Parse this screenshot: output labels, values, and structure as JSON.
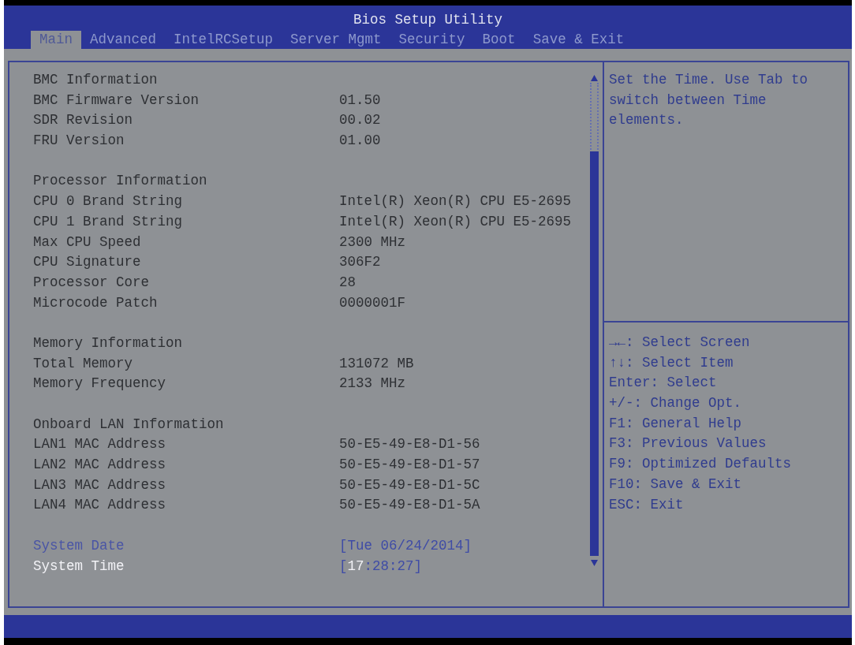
{
  "window": {
    "title": "Bios Setup Utility"
  },
  "tabs": [
    {
      "label": "Main",
      "selected": true
    },
    {
      "label": "Advanced",
      "selected": false
    },
    {
      "label": "IntelRCSetup",
      "selected": false
    },
    {
      "label": "Server Mgmt",
      "selected": false
    },
    {
      "label": "Security",
      "selected": false
    },
    {
      "label": "Boot",
      "selected": false
    },
    {
      "label": "Save & Exit",
      "selected": false
    }
  ],
  "main_panel": {
    "sections": [
      {
        "title": "BMC Information",
        "rows": [
          {
            "label": "BMC Firmware Version",
            "value": "01.50"
          },
          {
            "label": "SDR Revision",
            "value": "00.02"
          },
          {
            "label": "FRU Version",
            "value": "01.00"
          }
        ]
      },
      {
        "title": "Processor Information",
        "rows": [
          {
            "label": "CPU 0 Brand String",
            "value": "Intel(R) Xeon(R) CPU E5-2695"
          },
          {
            "label": "CPU 1 Brand String",
            "value": "Intel(R) Xeon(R) CPU E5-2695"
          },
          {
            "label": "Max CPU Speed",
            "value": "2300 MHz"
          },
          {
            "label": "CPU Signature",
            "value": "306F2"
          },
          {
            "label": "Processor Core",
            "value": "28"
          },
          {
            "label": "Microcode Patch",
            "value": "0000001F"
          }
        ]
      },
      {
        "title": "Memory Information",
        "rows": [
          {
            "label": "Total Memory",
            "value": "131072 MB"
          },
          {
            "label": "Memory Frequency",
            "value": "2133 MHz"
          }
        ]
      },
      {
        "title": "Onboard LAN Information",
        "rows": [
          {
            "label": "LAN1 MAC Address",
            "value": "50-E5-49-E8-D1-56"
          },
          {
            "label": "LAN2 MAC Address",
            "value": "50-E5-49-E8-D1-57"
          },
          {
            "label": "LAN3 MAC Address",
            "value": "50-E5-49-E8-D1-5C"
          },
          {
            "label": "LAN4 MAC Address",
            "value": "50-E5-49-E8-D1-5A"
          }
        ]
      }
    ],
    "settings": [
      {
        "label": "System Date",
        "selected": false,
        "segments": [
          {
            "text": "[Tue 06/24/2014]",
            "selected": false
          }
        ]
      },
      {
        "label": "System Time",
        "selected": true,
        "segments": [
          {
            "text": "[",
            "selected": false
          },
          {
            "text": "17",
            "selected": true
          },
          {
            "text": ":28:27]",
            "selected": false
          }
        ]
      }
    ]
  },
  "help_panel": {
    "description": "Set the Time. Use Tab to switch between Time elements.",
    "keys": [
      "→←: Select Screen",
      "↑↓: Select Item",
      "Enter: Select",
      "+/-: Change Opt.",
      "F1: General Help",
      "F3: Previous Values",
      "F9: Optimized Defaults",
      "F10: Save & Exit",
      "ESC: Exit"
    ]
  }
}
